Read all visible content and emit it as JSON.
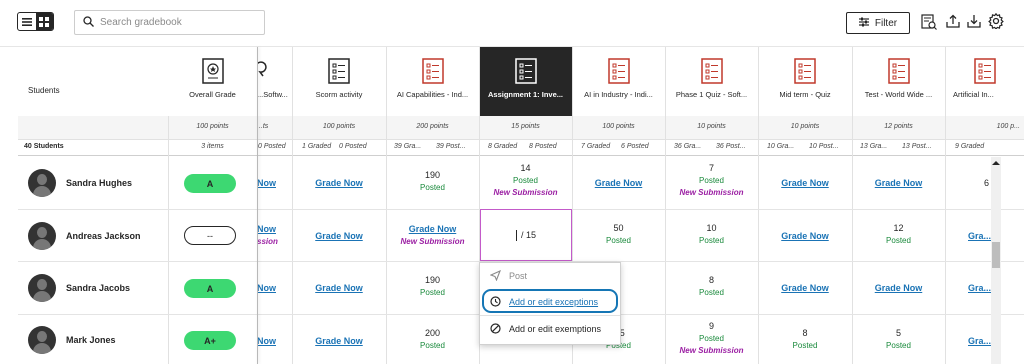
{
  "search": {
    "placeholder": "Search gradebook"
  },
  "toolbar": {
    "filter_label": "Filter"
  },
  "students_header": "Students",
  "overall_grade_header": "Overall Grade",
  "columns": [
    {
      "title": "...Softw...",
      "points": "...ts",
      "stat_left": "",
      "stat_right": "0 Posted"
    },
    {
      "title": "Scorm activity",
      "points": "100 points",
      "stat_left": "1 Graded",
      "stat_right": "0 Posted"
    },
    {
      "title": "AI Capabilities - Ind...",
      "points": "200 points",
      "stat_left": "39 Gra...",
      "stat_right": "39 Post..."
    },
    {
      "title": "Assignment 1: Inve...",
      "points": "15 points",
      "stat_left": "8 Graded",
      "stat_right": "8 Posted"
    },
    {
      "title": "AI in Industry - Indi...",
      "points": "100 points",
      "stat_left": "7 Graded",
      "stat_right": "6 Posted"
    },
    {
      "title": "Phase 1 Quiz - Soft...",
      "points": "10 points",
      "stat_left": "36 Gra...",
      "stat_right": "36 Post..."
    },
    {
      "title": "Mid term - Quiz",
      "points": "10 points",
      "stat_left": "10 Gra...",
      "stat_right": "10 Post..."
    },
    {
      "title": "Test - World Wide ...",
      "points": "12 points",
      "stat_left": "13 Gra...",
      "stat_right": "13 Post..."
    },
    {
      "title": "Artificial In...",
      "points": "100 p...",
      "stat_left": "9 Graded",
      "stat_right": ""
    }
  ],
  "overall_points": "100 points",
  "overall_stat": "3 items",
  "students_count": "40 Students",
  "students": [
    {
      "name": "Sandra Hughes",
      "grade": "A"
    },
    {
      "name": "Andreas Jackson",
      "grade": "--"
    },
    {
      "name": "Sandra Jacobs",
      "grade": "A"
    },
    {
      "name": "Mark Jones",
      "grade": "A+"
    }
  ],
  "labels": {
    "grade_now": "Grade Now",
    "posted": "Posted",
    "new_submission": "New Submission",
    "gnow_partial": "Gra...",
    "now_partial": "Now"
  },
  "values": {
    "r1_c2": "190",
    "r1_c3": "14",
    "r1_c5": "7",
    "r1_c8": "6",
    "r2_c4": "50",
    "r2_c5": "10",
    "r2_c7": "12",
    "r3_c2": "190",
    "r3_c5": "8",
    "r4_c2": "200",
    "r4_c4": "2.5",
    "r4_c5": "9",
    "r4_c6": "8",
    "r4_c7": "5"
  },
  "edit_cell": {
    "value": "/ 15"
  },
  "menu": {
    "post": "Post",
    "exceptions": "Add or edit exceptions",
    "exemptions": "Add or edit exemptions"
  }
}
